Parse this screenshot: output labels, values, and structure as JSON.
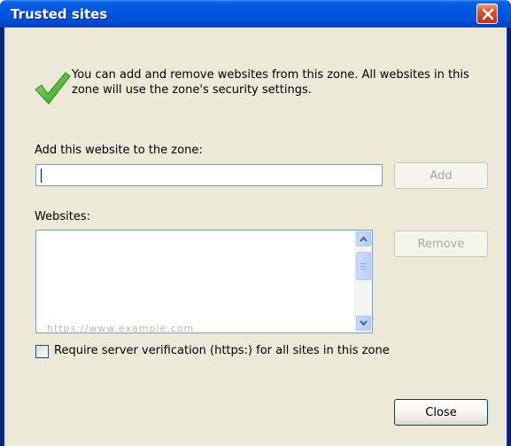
{
  "window": {
    "title": "Trusted sites"
  },
  "info": {
    "text": "You can add and remove websites from this zone. All websites in this zone will use the zone's security settings."
  },
  "add_site": {
    "label": "Add this website to the zone:",
    "value": "",
    "add_button": "Add"
  },
  "websites": {
    "label": "Websites:",
    "items": [
      {
        "label": "https://www.example.com"
      }
    ],
    "remove_button": "Remove"
  },
  "https_check": {
    "label": "Require server verification (https:) for all sites in this zone",
    "checked": false
  },
  "footer": {
    "close_button": "Close"
  },
  "icons": {
    "check": "green-checkmark-icon",
    "close": "close-icon"
  },
  "colors": {
    "title_bar": "#0055e5",
    "dialog_bg": "#ece9d8",
    "close_button": "#d9543a",
    "check_green": "#3fae2a"
  }
}
